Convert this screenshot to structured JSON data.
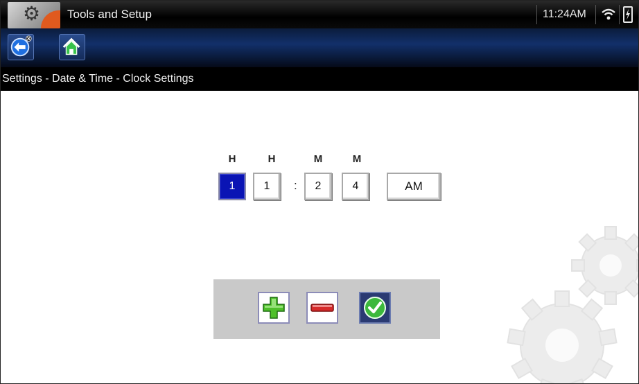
{
  "header": {
    "title": "Tools and Setup",
    "time": "11:24AM",
    "app_icon": "tools-gear-icon",
    "wifi_icon": "wifi-icon",
    "battery_icon": "battery-charging-icon"
  },
  "toolbar": {
    "back_icon": "back-arrow-icon",
    "home_icon": "home-icon"
  },
  "breadcrumb": "Settings - Date & Time - Clock Settings",
  "clock_settings": {
    "labels": [
      "H",
      "H",
      "M",
      "M"
    ],
    "digits": [
      "1",
      "1",
      "2",
      "4"
    ],
    "separator": ":",
    "ampm": "AM",
    "selected_index": 0
  },
  "controls": {
    "increment_icon": "plus-icon",
    "decrement_icon": "minus-icon",
    "accept_icon": "check-icon"
  },
  "colors": {
    "selected_digit": "#0a14b4",
    "toolbar": "#12306a",
    "plus": "#4ec02a",
    "minus": "#d62a2a",
    "check": "#3cb83c"
  }
}
